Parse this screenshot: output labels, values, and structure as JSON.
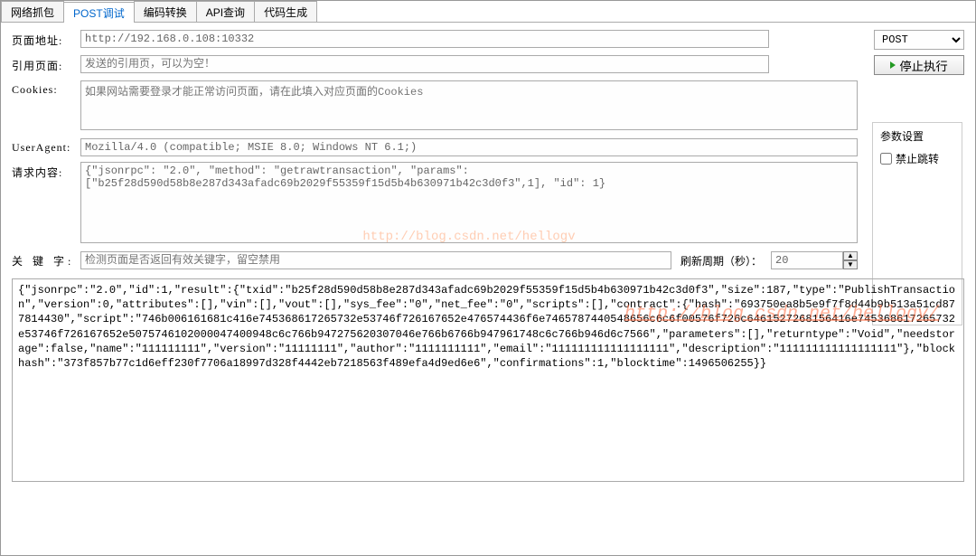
{
  "tabs": [
    "网络抓包",
    "POST调试",
    "编码转换",
    "API查询",
    "代码生成"
  ],
  "active_tab": 1,
  "labels": {
    "url": "页面地址:",
    "referer": "引用页面:",
    "cookies": "Cookies:",
    "ua": "UserAgent:",
    "body": "请求内容:",
    "keywords": "关 键 字:",
    "refresh": "刷新周期（秒）：",
    "params_title": "参数设置",
    "no_redirect": "禁止跳转"
  },
  "values": {
    "url": "http://192.168.0.108:10332",
    "method": "POST",
    "referer_ph": "发送的引用页，可以为空！",
    "cookies_ph": "如果网站需要登录才能正常访问页面，请在此填入对应页面的Cookies",
    "ua": "Mozilla/4.0 (compatible; MSIE 8.0; Windows NT 6.1;)",
    "body": "{\"jsonrpc\": \"2.0\", \"method\": \"getrawtransaction\", \"params\": [\"b25f28d590d58b8e287d343afadc69b2029f55359f15d5b4b630971b42c3d0f3\",1], \"id\": 1}",
    "keywords_ph": "检测页面是否返回有效关键字，留空禁用",
    "refresh": "20",
    "no_redirect_checked": false
  },
  "run_button": "停止执行",
  "watermark1": "http://blog.csdn.net/hellogv",
  "watermark2": "http://blog.csdn.net/hellogv/",
  "response": "{\"jsonrpc\":\"2.0\",\"id\":1,\"result\":{\"txid\":\"b25f28d590d58b8e287d343afadc69b2029f55359f15d5b4b630971b42c3d0f3\",\"size\":187,\"type\":\"PublishTransaction\",\"version\":0,\"attributes\":[],\"vin\":[],\"vout\":[],\"sys_fee\":\"0\",\"net_fee\":\"0\",\"scripts\":[],\"contract\":{\"hash\":\"693750ea8b5e9f7f8d44b9b513a51cd877814430\",\"script\":\"746b006161681c416e745368617265732e53746f726167652e476574436f6e7465787440548656c6c6f00576f726c6461527268156416e745368617265732e53746f726167652e5075746102000047400948c6c766b947275620307046e766b6766b947961748c6c766b946d6c7566\",\"parameters\":[],\"returntype\":\"Void\",\"needstorage\":false,\"name\":\"111111111\",\"version\":\"11111111\",\"author\":\"1111111111\",\"email\":\"111111111111111111\",\"description\":\"111111111111111111\"},\"blockhash\":\"373f857b77c1d6eff230f7706a18997d328f4442eb7218563f489efa4d9ed6e6\",\"confirmations\":1,\"blocktime\":1496506255}}"
}
